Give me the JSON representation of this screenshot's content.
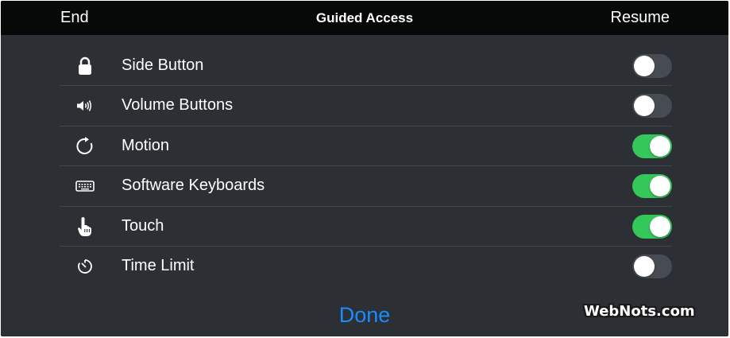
{
  "header": {
    "end_label": "End",
    "title": "Guided Access",
    "resume_label": "Resume"
  },
  "options": [
    {
      "label": "Side Button",
      "icon": "lock-icon",
      "enabled": false
    },
    {
      "label": "Volume Buttons",
      "icon": "speaker-icon",
      "enabled": false
    },
    {
      "label": "Motion",
      "icon": "rotate-icon",
      "enabled": true
    },
    {
      "label": "Software Keyboards",
      "icon": "keyboard-icon",
      "enabled": true
    },
    {
      "label": "Touch",
      "icon": "hand-pointer-icon",
      "enabled": true
    },
    {
      "label": "Time Limit",
      "icon": "timer-icon",
      "enabled": false
    }
  ],
  "footer": {
    "done_label": "Done"
  },
  "watermark": "WebNots.com",
  "colors": {
    "background": "#2c2f33",
    "topbar": "#070808",
    "toggle_on": "#34c759",
    "toggle_off": "#474c54",
    "accent": "#1a8cff"
  }
}
